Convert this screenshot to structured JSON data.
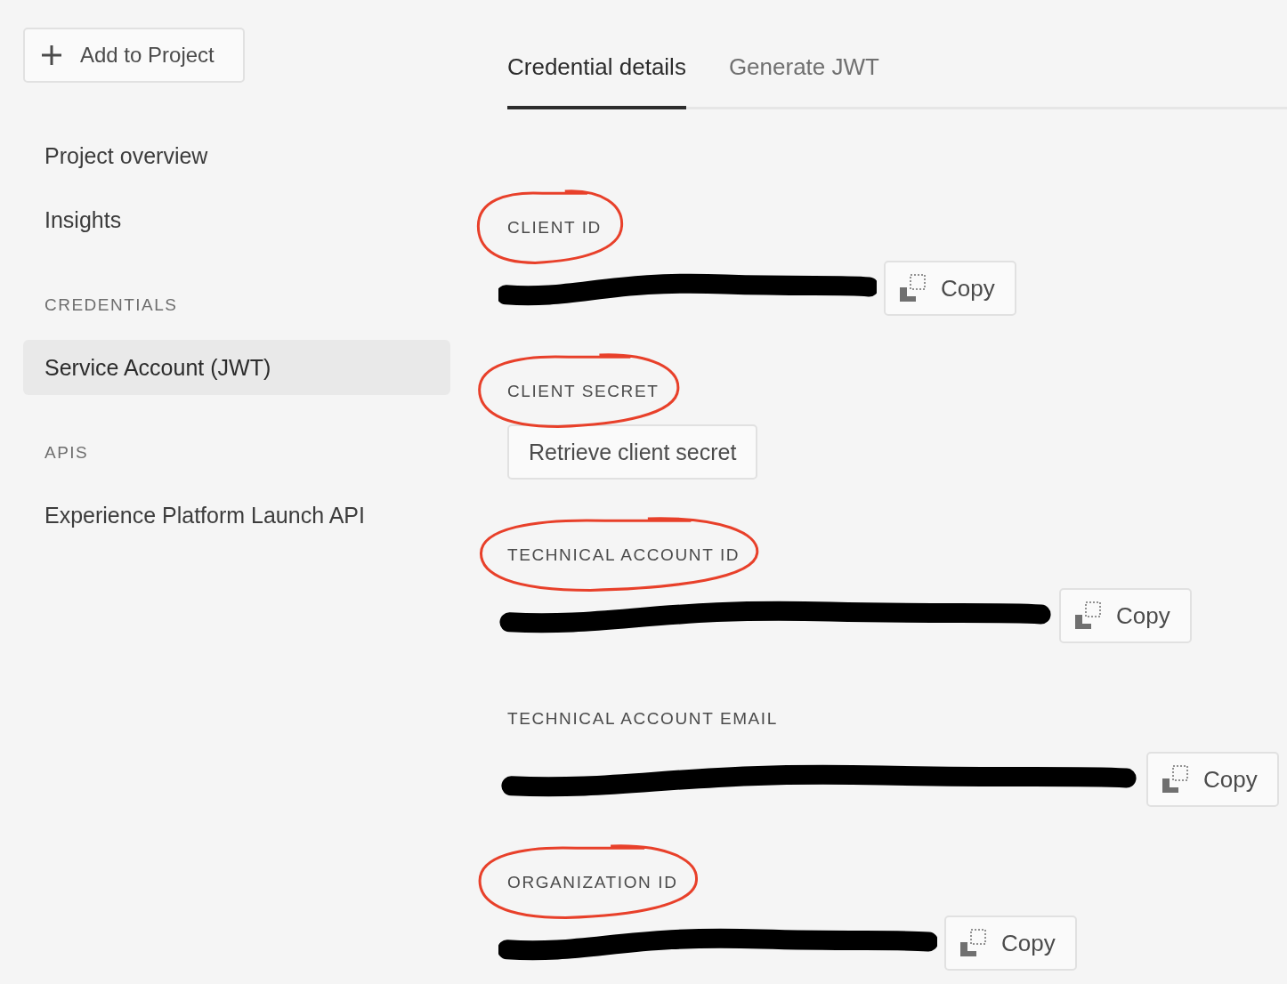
{
  "add_button": {
    "label": "Add to Project"
  },
  "sidebar": {
    "items": [
      {
        "kind": "item",
        "label": "Project overview",
        "selected": false
      },
      {
        "kind": "item",
        "label": "Insights",
        "selected": false
      },
      {
        "kind": "heading",
        "label": "CREDENTIALS"
      },
      {
        "kind": "item",
        "label": "Service Account (JWT)",
        "selected": true
      },
      {
        "kind": "heading",
        "label": "APIS"
      },
      {
        "kind": "item",
        "label": "Experience Platform Launch API",
        "selected": false
      }
    ]
  },
  "tabs": [
    {
      "label": "Credential details",
      "selected": true
    },
    {
      "label": "Generate JWT",
      "selected": false
    }
  ],
  "fields": [
    {
      "label": "CLIENT ID",
      "circled": true,
      "kind": "redacted_copy",
      "button": "Copy"
    },
    {
      "label": "CLIENT SECRET",
      "circled": true,
      "kind": "action",
      "button": "Retrieve client secret"
    },
    {
      "label": "TECHNICAL ACCOUNT ID",
      "circled": true,
      "kind": "redacted_copy",
      "button": "Copy"
    },
    {
      "label": "TECHNICAL ACCOUNT EMAIL",
      "circled": false,
      "kind": "redacted_copy",
      "button": "Copy"
    },
    {
      "label": "ORGANIZATION ID",
      "circled": true,
      "kind": "redacted_copy",
      "button": "Copy"
    }
  ]
}
